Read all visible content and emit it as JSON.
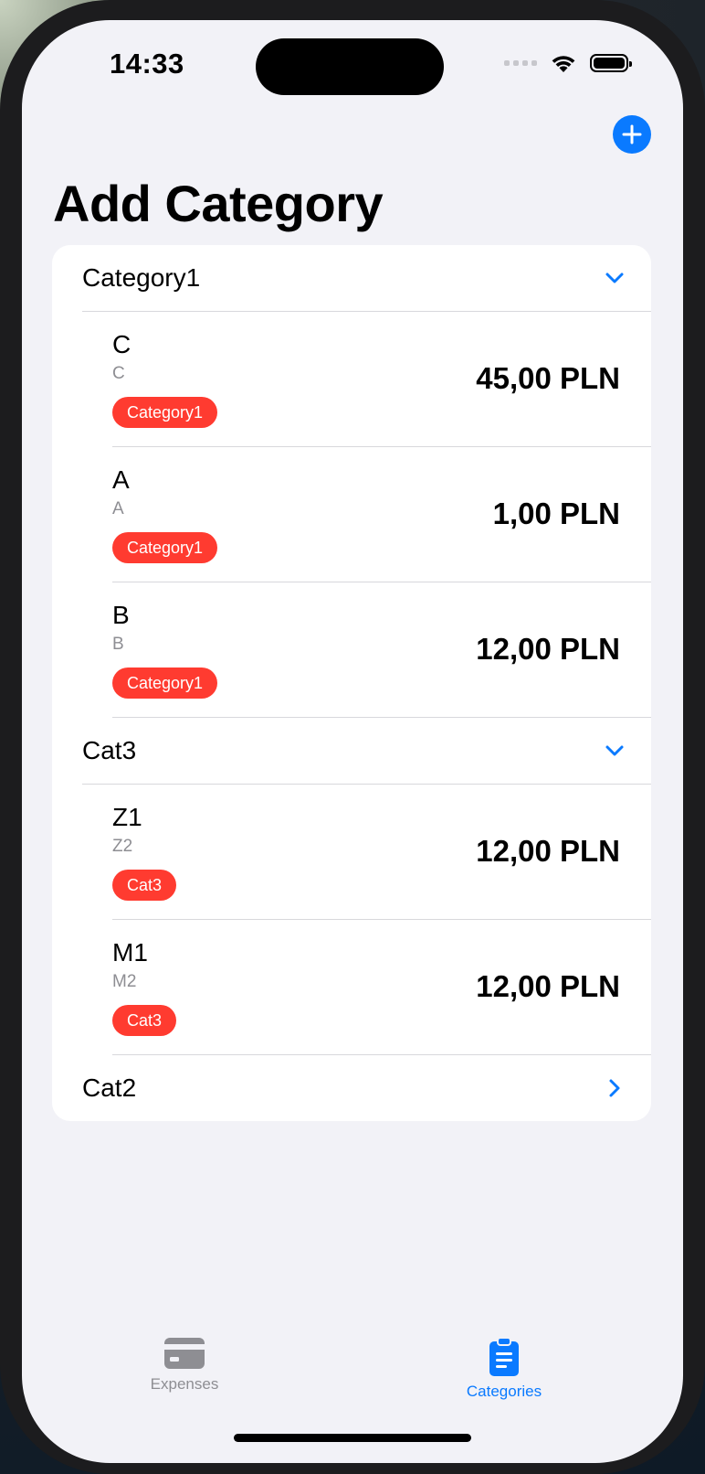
{
  "status_bar": {
    "time": "14:33"
  },
  "page": {
    "title": "Add Category"
  },
  "colors": {
    "accent": "#0a7aff",
    "badge": "#ff3b30"
  },
  "sections": [
    {
      "name": "Category1",
      "expanded": true,
      "items": [
        {
          "title": "C",
          "subtitle": "C",
          "badge": "Category1",
          "amount": "45,00 PLN"
        },
        {
          "title": "A",
          "subtitle": "A",
          "badge": "Category1",
          "amount": "1,00 PLN"
        },
        {
          "title": "B",
          "subtitle": "B",
          "badge": "Category1",
          "amount": "12,00 PLN"
        }
      ]
    },
    {
      "name": "Cat3",
      "expanded": true,
      "items": [
        {
          "title": "Z1",
          "subtitle": "Z2",
          "badge": "Cat3",
          "amount": "12,00 PLN"
        },
        {
          "title": "M1",
          "subtitle": "M2",
          "badge": "Cat3",
          "amount": "12,00 PLN"
        }
      ]
    },
    {
      "name": "Cat2",
      "expanded": false,
      "items": []
    }
  ],
  "tabbar": {
    "tabs": [
      {
        "label": "Expenses",
        "icon": "credit-card-icon",
        "selected": false
      },
      {
        "label": "Categories",
        "icon": "clipboard-list-icon",
        "selected": true
      }
    ]
  }
}
